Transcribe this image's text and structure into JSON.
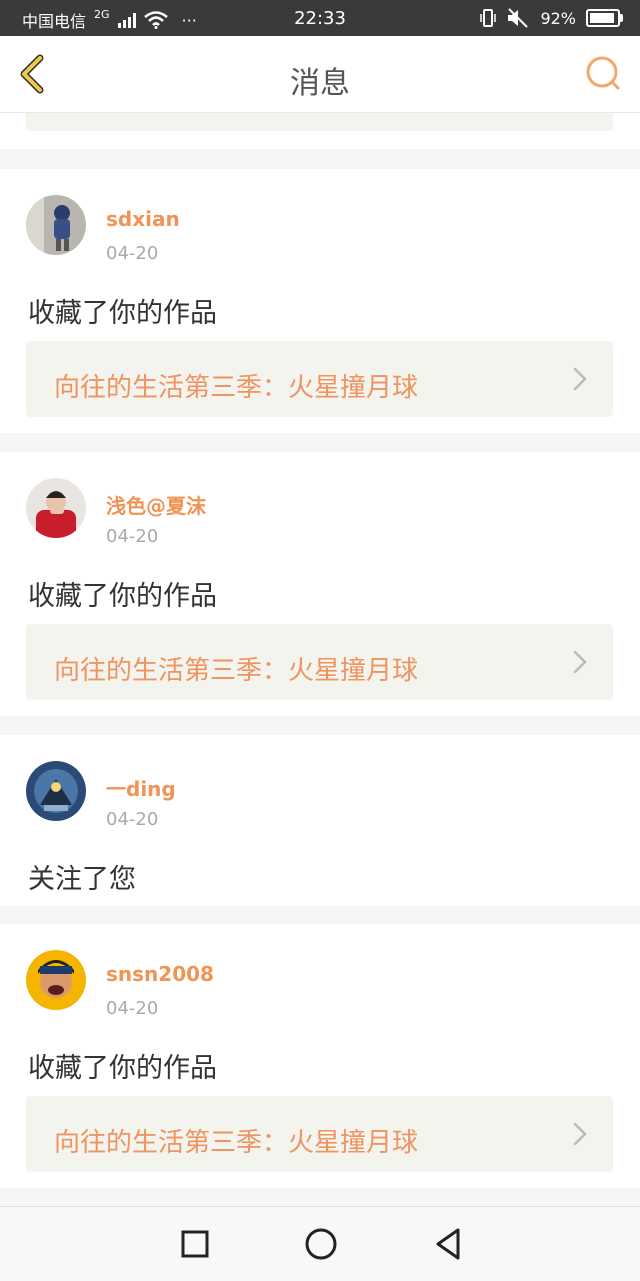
{
  "status_bar": {
    "carrier": "中国电信",
    "network": "2G",
    "dots": "···",
    "time": "22:33",
    "battery": "92%",
    "battery_level": 0.92
  },
  "header": {
    "title": "消息",
    "back_icon": "chevron-left-icon",
    "search_icon": "search-icon",
    "accent_color": "#f5a66d",
    "back_color": "#f2c94c"
  },
  "messages": [
    {
      "username": "sdxian",
      "date": "04-20",
      "action": "收藏了你的作品",
      "work_title": "向往的生活第三季：火星撞月球"
    },
    {
      "username": "浅色@夏沫",
      "date": "04-20",
      "action": "收藏了你的作品",
      "work_title": "向往的生活第三季：火星撞月球"
    },
    {
      "username": "一ding",
      "date": "04-20",
      "action": "关注了您"
    },
    {
      "username": "snsn2008",
      "date": "04-20",
      "action": "收藏了你的作品",
      "work_title": "向往的生活第三季：火星撞月球"
    }
  ],
  "colors": {
    "username": "#f09455",
    "link_text": "#ef9361",
    "link_bg": "#f4f4ef"
  },
  "nav_bar": {
    "items": [
      "recent-apps-icon",
      "home-icon",
      "back-icon"
    ]
  }
}
